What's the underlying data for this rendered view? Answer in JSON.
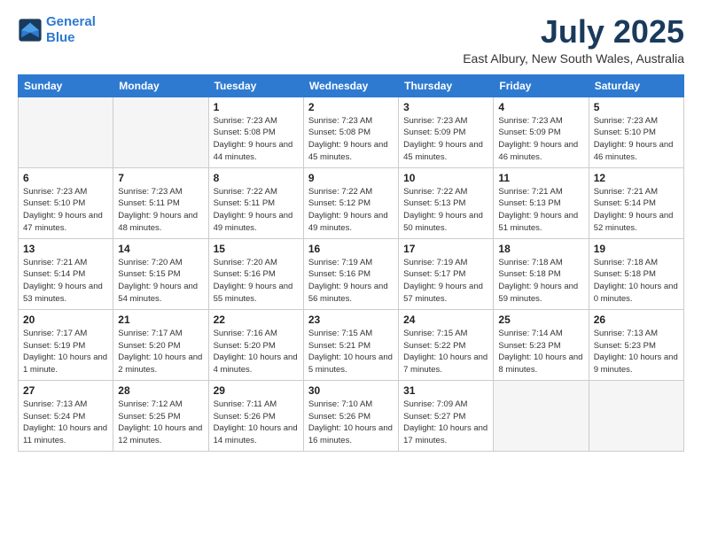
{
  "logo": {
    "line1": "General",
    "line2": "Blue"
  },
  "title": "July 2025",
  "location": "East Albury, New South Wales, Australia",
  "days_of_week": [
    "Sunday",
    "Monday",
    "Tuesday",
    "Wednesday",
    "Thursday",
    "Friday",
    "Saturday"
  ],
  "weeks": [
    [
      {
        "day": "",
        "info": ""
      },
      {
        "day": "",
        "info": ""
      },
      {
        "day": "1",
        "info": "Sunrise: 7:23 AM\nSunset: 5:08 PM\nDaylight: 9 hours\nand 44 minutes."
      },
      {
        "day": "2",
        "info": "Sunrise: 7:23 AM\nSunset: 5:08 PM\nDaylight: 9 hours\nand 45 minutes."
      },
      {
        "day": "3",
        "info": "Sunrise: 7:23 AM\nSunset: 5:09 PM\nDaylight: 9 hours\nand 45 minutes."
      },
      {
        "day": "4",
        "info": "Sunrise: 7:23 AM\nSunset: 5:09 PM\nDaylight: 9 hours\nand 46 minutes."
      },
      {
        "day": "5",
        "info": "Sunrise: 7:23 AM\nSunset: 5:10 PM\nDaylight: 9 hours\nand 46 minutes."
      }
    ],
    [
      {
        "day": "6",
        "info": "Sunrise: 7:23 AM\nSunset: 5:10 PM\nDaylight: 9 hours\nand 47 minutes."
      },
      {
        "day": "7",
        "info": "Sunrise: 7:23 AM\nSunset: 5:11 PM\nDaylight: 9 hours\nand 48 minutes."
      },
      {
        "day": "8",
        "info": "Sunrise: 7:22 AM\nSunset: 5:11 PM\nDaylight: 9 hours\nand 49 minutes."
      },
      {
        "day": "9",
        "info": "Sunrise: 7:22 AM\nSunset: 5:12 PM\nDaylight: 9 hours\nand 49 minutes."
      },
      {
        "day": "10",
        "info": "Sunrise: 7:22 AM\nSunset: 5:13 PM\nDaylight: 9 hours\nand 50 minutes."
      },
      {
        "day": "11",
        "info": "Sunrise: 7:21 AM\nSunset: 5:13 PM\nDaylight: 9 hours\nand 51 minutes."
      },
      {
        "day": "12",
        "info": "Sunrise: 7:21 AM\nSunset: 5:14 PM\nDaylight: 9 hours\nand 52 minutes."
      }
    ],
    [
      {
        "day": "13",
        "info": "Sunrise: 7:21 AM\nSunset: 5:14 PM\nDaylight: 9 hours\nand 53 minutes."
      },
      {
        "day": "14",
        "info": "Sunrise: 7:20 AM\nSunset: 5:15 PM\nDaylight: 9 hours\nand 54 minutes."
      },
      {
        "day": "15",
        "info": "Sunrise: 7:20 AM\nSunset: 5:16 PM\nDaylight: 9 hours\nand 55 minutes."
      },
      {
        "day": "16",
        "info": "Sunrise: 7:19 AM\nSunset: 5:16 PM\nDaylight: 9 hours\nand 56 minutes."
      },
      {
        "day": "17",
        "info": "Sunrise: 7:19 AM\nSunset: 5:17 PM\nDaylight: 9 hours\nand 57 minutes."
      },
      {
        "day": "18",
        "info": "Sunrise: 7:18 AM\nSunset: 5:18 PM\nDaylight: 9 hours\nand 59 minutes."
      },
      {
        "day": "19",
        "info": "Sunrise: 7:18 AM\nSunset: 5:18 PM\nDaylight: 10 hours\nand 0 minutes."
      }
    ],
    [
      {
        "day": "20",
        "info": "Sunrise: 7:17 AM\nSunset: 5:19 PM\nDaylight: 10 hours\nand 1 minute."
      },
      {
        "day": "21",
        "info": "Sunrise: 7:17 AM\nSunset: 5:20 PM\nDaylight: 10 hours\nand 2 minutes."
      },
      {
        "day": "22",
        "info": "Sunrise: 7:16 AM\nSunset: 5:20 PM\nDaylight: 10 hours\nand 4 minutes."
      },
      {
        "day": "23",
        "info": "Sunrise: 7:15 AM\nSunset: 5:21 PM\nDaylight: 10 hours\nand 5 minutes."
      },
      {
        "day": "24",
        "info": "Sunrise: 7:15 AM\nSunset: 5:22 PM\nDaylight: 10 hours\nand 7 minutes."
      },
      {
        "day": "25",
        "info": "Sunrise: 7:14 AM\nSunset: 5:23 PM\nDaylight: 10 hours\nand 8 minutes."
      },
      {
        "day": "26",
        "info": "Sunrise: 7:13 AM\nSunset: 5:23 PM\nDaylight: 10 hours\nand 9 minutes."
      }
    ],
    [
      {
        "day": "27",
        "info": "Sunrise: 7:13 AM\nSunset: 5:24 PM\nDaylight: 10 hours\nand 11 minutes."
      },
      {
        "day": "28",
        "info": "Sunrise: 7:12 AM\nSunset: 5:25 PM\nDaylight: 10 hours\nand 12 minutes."
      },
      {
        "day": "29",
        "info": "Sunrise: 7:11 AM\nSunset: 5:26 PM\nDaylight: 10 hours\nand 14 minutes."
      },
      {
        "day": "30",
        "info": "Sunrise: 7:10 AM\nSunset: 5:26 PM\nDaylight: 10 hours\nand 16 minutes."
      },
      {
        "day": "31",
        "info": "Sunrise: 7:09 AM\nSunset: 5:27 PM\nDaylight: 10 hours\nand 17 minutes."
      },
      {
        "day": "",
        "info": ""
      },
      {
        "day": "",
        "info": ""
      }
    ]
  ]
}
